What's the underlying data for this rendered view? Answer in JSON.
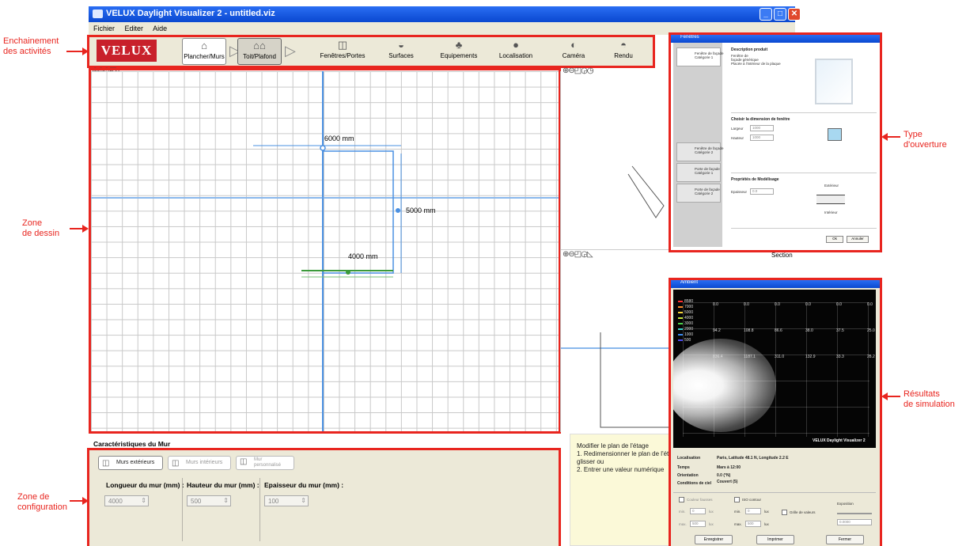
{
  "annotations": {
    "enchainement": "Enchainement\ndes activités",
    "zone_dessin": "Zone\nde dessin",
    "zone_config": "Zone de\nconfiguration",
    "type_ouverture": "Type\nd'ouverture",
    "resultats": "Résultats\nde simulation"
  },
  "window": {
    "title": "VELUX Daylight Visualizer 2 - untitled.viz",
    "controls": [
      "_",
      "□",
      "✕"
    ]
  },
  "menu": [
    "Fichier",
    "Editer",
    "Aide"
  ],
  "toolbar": {
    "logo": "VELUX",
    "tools": [
      {
        "label": "Plancher/Murs",
        "icon": "floor-walls-icon"
      },
      {
        "label": "Toit/Plafond",
        "icon": "roof-ceiling-icon"
      },
      {
        "label": "Fenêtres/Portes",
        "icon": "windows-doors-icon"
      },
      {
        "label": "Surfaces",
        "icon": "surfaces-icon"
      },
      {
        "label": "Equipements",
        "icon": "equipment-icon"
      },
      {
        "label": "Localisation",
        "icon": "globe-icon"
      },
      {
        "label": "Caméra",
        "icon": "camera-icon"
      },
      {
        "label": "Rendu",
        "icon": "render-icon"
      }
    ]
  },
  "drawing": {
    "dim_top": "6000 mm",
    "dim_right": "5000 mm",
    "dim_bottom": "4000 mm"
  },
  "views": {
    "section_label": "Section"
  },
  "config": {
    "title": "Caractéristiques du Mur",
    "buttons": [
      "Murs extérieurs",
      "Murs intérieurs",
      "Mur\npersonnalisé"
    ],
    "length_label": "Longueur du mur (mm) :",
    "height_label": "Hauteur du mur (mm) :",
    "thickness_label": "Epaisseur du mur (mm) :",
    "length_value": "4000",
    "height_value": "500",
    "thickness_value": "100"
  },
  "help": {
    "text": "Modifier le plan de l'étage\n1. Redimensionner le plan de l'étage\nglisser ou\n2. Entrer une valeur numérique"
  },
  "openings_dialog": {
    "title": "Fenêtres",
    "tabs": [
      "Fenêtre de façade\nCatégorie 1",
      "Fenêtre de façade\nCatégorie 2",
      "Porte de façade\nCatégorie 1",
      "Porte de façade\nCatégorie 2"
    ],
    "description_title": "Description produit",
    "description": "Fenêtre de\nfaçade générique\nPlacée à l'intérieur de la plaque",
    "dimension_title": "Choisir la dimension de fenêtre",
    "width_label": "Largeur",
    "height_label": "Hauteur",
    "width_value": "1000",
    "height_value": "1000",
    "modeling_title": "Propriétés de Modélisage",
    "thickness_label": "Epaisseur",
    "thickness_value": "0.0",
    "exterior_label": "Extérieur",
    "interior_label": "Intérieur",
    "ok": "Ok",
    "cancel": "Annuler"
  },
  "results_dialog": {
    "title": "Ambient",
    "legend": [
      {
        "value": "8580",
        "color": "#ff3030"
      },
      {
        "value": "7000",
        "color": "#ff8a2a"
      },
      {
        "value": "5000",
        "color": "#f5d23a"
      },
      {
        "value": "4000",
        "color": "#c8e83a"
      },
      {
        "value": "3000",
        "color": "#4ad04a"
      },
      {
        "value": "2000",
        "color": "#3ad0c8"
      },
      {
        "value": "1000",
        "color": "#3a8af0"
      },
      {
        "value": "500",
        "color": "#4a4af0"
      }
    ],
    "grid_values": [
      "0.0",
      "0.0",
      "0.0",
      "0.0",
      "0.0",
      "0.0",
      "94.2",
      "108.8",
      "86.6",
      "38.0",
      "37.5",
      "25.0",
      "836.4",
      "1187.1",
      "311.0",
      "132.9",
      "33.3",
      "28.2"
    ],
    "brand": "VELUX Daylight Visualizer 2",
    "location_label": "Localisation",
    "location_value": "Paris, Latitude 48.1 N, Longitude 2.2 E",
    "time_label": "Temps",
    "time_value": "Mars à 12:00",
    "orientation_label": "Orientation",
    "orientation_value": "0.0 (°N)",
    "sky_label": "Conditions de ciel",
    "sky_value": "Couvert (5)",
    "contour_label": "Couleur fausses",
    "contour2_label": "ISO contour",
    "grid_label": "Grille de valeurs",
    "exposure_label": "Exposition",
    "exposure_value": "0.0000",
    "min_label": "min.",
    "max_label": "max.",
    "min_value": "0",
    "max_value": "500",
    "unit": "lux",
    "buttons": [
      "Enregistrer",
      "Imprimer",
      "Fermer"
    ]
  }
}
